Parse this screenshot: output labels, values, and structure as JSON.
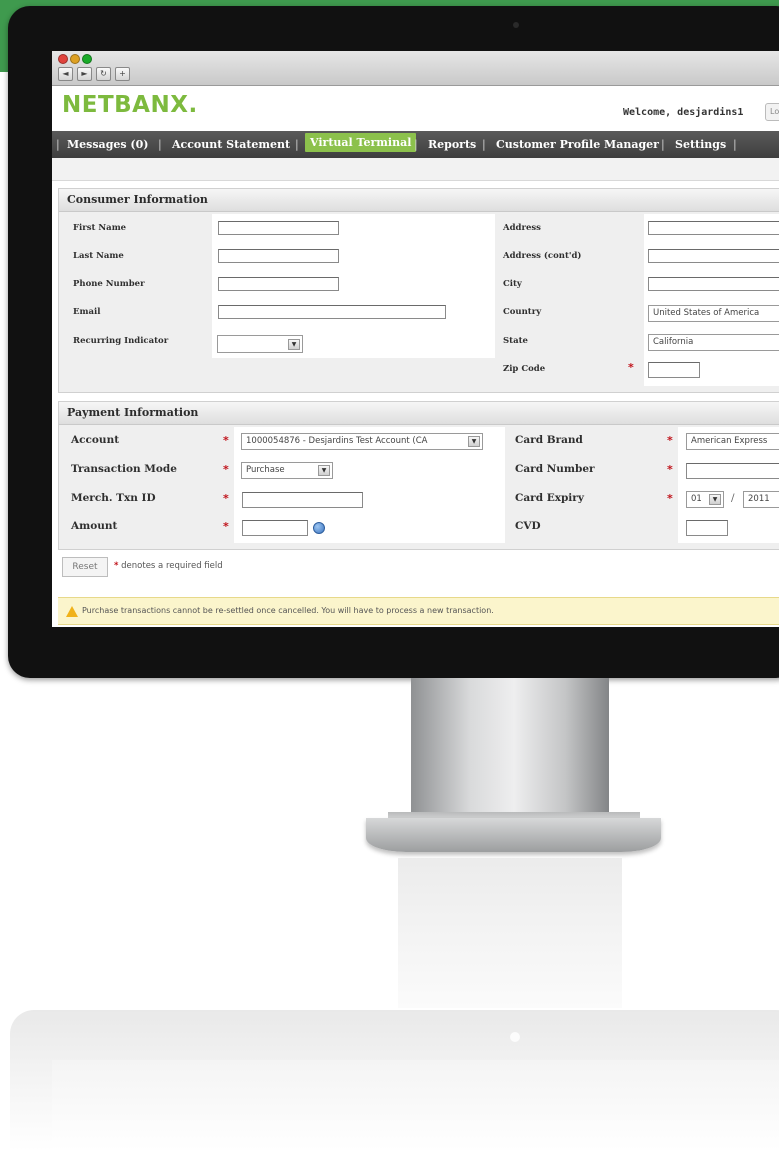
{
  "browser": {
    "nav_back": "◄",
    "nav_fwd": "►",
    "refresh": "↻",
    "add": "+"
  },
  "header": {
    "logo": "NETBANX",
    "logo_dot": ".",
    "welcome": "Welcome, desjardins1",
    "logout_partial": "Lo"
  },
  "nav": {
    "items": [
      "Messages (0)",
      "Account Statement",
      "Virtual Terminal",
      "Reports",
      "Customer Profile Manager",
      "Settings"
    ],
    "separator": "|",
    "active": "Virtual Terminal"
  },
  "consumer": {
    "title": "Consumer Information",
    "first_name": {
      "label": "First Name",
      "value": ""
    },
    "last_name": {
      "label": "Last Name",
      "value": ""
    },
    "phone": {
      "label": "Phone Number",
      "value": ""
    },
    "email": {
      "label": "Email",
      "value": ""
    },
    "recurring": {
      "label": "Recurring Indicator",
      "value": ""
    },
    "address": {
      "label": "Address",
      "value": ""
    },
    "address2": {
      "label": "Address (cont'd)",
      "value": ""
    },
    "city": {
      "label": "City",
      "value": ""
    },
    "country": {
      "label": "Country",
      "value": "United States of America"
    },
    "state": {
      "label": "State",
      "value": "California"
    },
    "zip": {
      "label": "Zip Code",
      "value": ""
    }
  },
  "payment": {
    "title": "Payment Information",
    "account": {
      "label": "Account",
      "value": "1000054876 - Desjardins Test Account (CA"
    },
    "txn_mode": {
      "label": "Transaction Mode",
      "value": "Purchase"
    },
    "merch_txn": {
      "label": "Merch. Txn ID",
      "value": ""
    },
    "amount": {
      "label": "Amount",
      "value": ""
    },
    "card_brand": {
      "label": "Card Brand",
      "value": "American Express"
    },
    "card_number": {
      "label": "Card Number",
      "value": ""
    },
    "card_expiry": {
      "label": "Card Expiry",
      "month": "01",
      "slash": "/",
      "year": "2011"
    },
    "cvd": {
      "label": "CVD",
      "value": ""
    }
  },
  "form": {
    "reset": "Reset",
    "required_star": "*",
    "required_note": "denotes a required field"
  },
  "warning": "Purchase transactions cannot be re-settled once cancelled. You will have to process a new transaction.",
  "colors": {
    "brand_green": "#7dba3e",
    "active_tab": "#8cc14c",
    "required": "#c0141c",
    "band": "#3f9a4e"
  }
}
